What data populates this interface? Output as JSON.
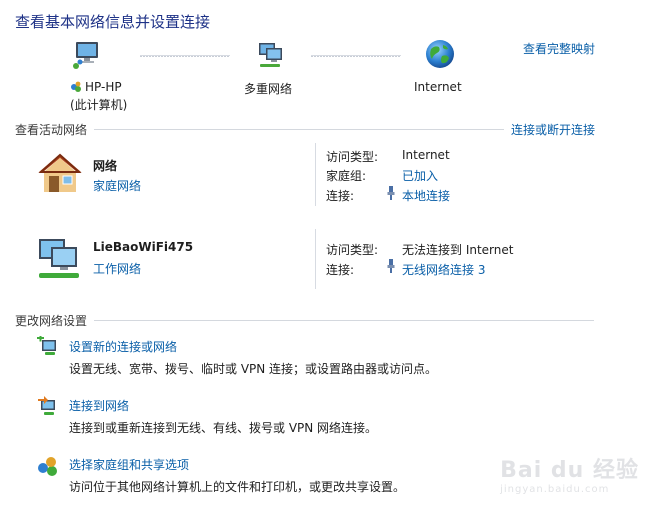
{
  "header": {
    "title": "查看基本网络信息并设置连接",
    "map_link": "查看完整映射"
  },
  "network_map": {
    "computer_name": "HP-HP",
    "computer_sub": "(此计算机)",
    "middle": "多重网络",
    "internet": "Internet"
  },
  "active_section": {
    "heading": "查看活动网络",
    "connect_link": "连接或断开连接",
    "networks": [
      {
        "name": "网络",
        "type": "家庭网络",
        "rows": [
          {
            "label": "访问类型:",
            "value": "Internet"
          },
          {
            "label": "家庭组:",
            "value": "已加入"
          },
          {
            "label": "连接:",
            "value": "本地连接"
          }
        ]
      },
      {
        "name": "LieBaoWiFi475",
        "type": "工作网络",
        "rows": [
          {
            "label": "访问类型:",
            "value": "无法连接到 Internet"
          },
          {
            "label": "连接:",
            "value": "无线网络连接 3"
          }
        ]
      }
    ]
  },
  "settings_section": {
    "heading": "更改网络设置",
    "tasks": [
      {
        "title": "设置新的连接或网络",
        "desc": "设置无线、宽带、拨号、临时或 VPN 连接；或设置路由器或访问点。"
      },
      {
        "title": "连接到网络",
        "desc": "连接到或重新连接到无线、有线、拨号或 VPN 网络连接。"
      },
      {
        "title": "选择家庭组和共享选项",
        "desc": "访问位于其他网络计算机上的文件和打印机，或更改共享设置。"
      }
    ]
  },
  "watermark": {
    "brand": "Bai du 经验",
    "url": "jingyan.baidu.com"
  }
}
